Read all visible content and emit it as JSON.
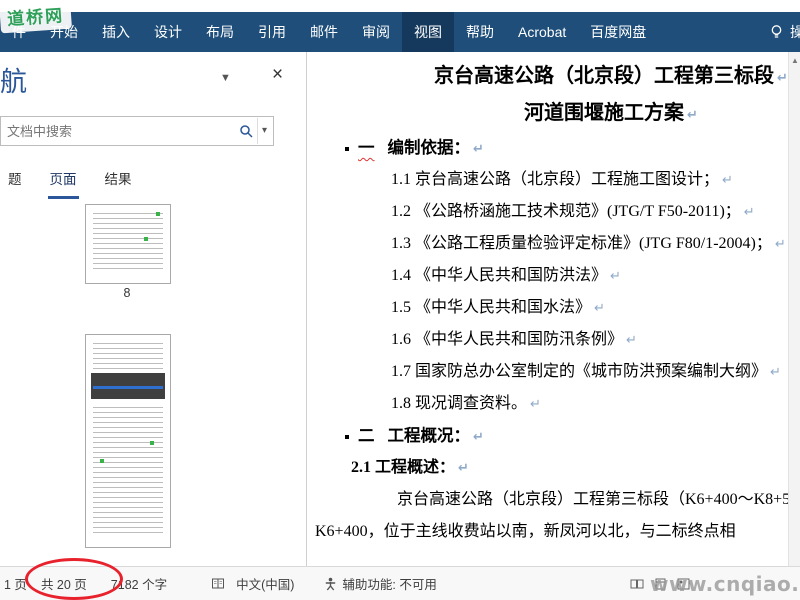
{
  "watermarks": {
    "top_left": "道桥网",
    "bottom_right": "www.cnqiao.com"
  },
  "ribbon": {
    "tabs": [
      {
        "label": "件"
      },
      {
        "label": "开始"
      },
      {
        "label": "插入"
      },
      {
        "label": "设计"
      },
      {
        "label": "布局"
      },
      {
        "label": "引用"
      },
      {
        "label": "邮件"
      },
      {
        "label": "审阅"
      },
      {
        "label": "视图",
        "active": true
      },
      {
        "label": "帮助"
      },
      {
        "label": "Acrobat"
      },
      {
        "label": "百度网盘"
      }
    ],
    "tell_me_label": "操"
  },
  "nav_pane": {
    "title": "航",
    "search_placeholder": "文档中搜索",
    "tabs": [
      {
        "label": "题"
      },
      {
        "label": "页面",
        "active": true
      },
      {
        "label": "结果"
      }
    ],
    "thumbnails": [
      {
        "page_number": "8"
      },
      {
        "page_number": ""
      }
    ]
  },
  "document": {
    "title_lines": [
      "京台高速公路（北京段）工程第三标段",
      "河道围堰施工方案"
    ],
    "heading1": {
      "marker": "一",
      "text": "编制依据："
    },
    "items": [
      "1.1 京台高速公路（北京段）工程施工图设计；",
      "1.2 《公路桥涵施工技术规范》(JTG/T F50-2011)；",
      "1.3 《公路工程质量检验评定标准》(JTG F80/1-2004)；",
      "1.4 《中华人民共和国防洪法》",
      "1.5 《中华人民共和国水法》",
      "1.6 《中华人民共和国防汛条例》",
      "1.7 国家防总办公室制定的《城市防洪预案编制大纲》",
      "1.8 现况调查资料。"
    ],
    "heading2": {
      "marker": "二",
      "text": "工程概况："
    },
    "heading2_sub": "2.1 工程概述：",
    "paragraph_lines": [
      "京台高速公路（北京段）工程第三标段（K6+400～K8+5",
      "K6+400，位于主线收费站以南，新凤河以北，与二标终点相"
    ]
  },
  "status_bar": {
    "page_indicator": "1 页",
    "total_pages": "共 20 页",
    "word_count": "7182 个字",
    "language": "中文(中国)",
    "accessibility": "辅助功能: 不可用"
  }
}
